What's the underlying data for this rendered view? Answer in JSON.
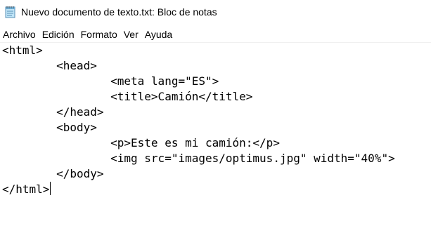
{
  "window": {
    "title": "Nuevo documento de texto.txt: Bloc de notas",
    "icon": "notepad-icon"
  },
  "menu": {
    "items": [
      "Archivo",
      "Edición",
      "Formato",
      "Ver",
      "Ayuda"
    ]
  },
  "editor": {
    "lines": [
      "<html>",
      "\t<head>",
      "\t\t<meta lang=\"ES\">",
      "\t\t<title>Camión</title>",
      "\t</head>",
      "\t<body>",
      "\t\t<p>Este es mi camión:</p>",
      "\t\t<img src=\"images/optimus.jpg\" width=\"40%\">",
      "\t</body>",
      "</html>"
    ],
    "indent_levels": [
      0,
      1,
      2,
      2,
      1,
      1,
      2,
      2,
      1,
      0
    ]
  }
}
